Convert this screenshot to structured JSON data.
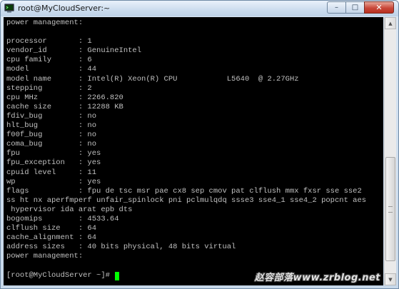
{
  "window": {
    "title": "root@MyCloudServer:~",
    "controls": {
      "minimize_glyph": "–",
      "maximize_glyph": "□",
      "close_glyph": "✕"
    },
    "icon": "terminal-app-icon"
  },
  "terminal": {
    "colors": {
      "background": "#000000",
      "text": "#c0c0c0",
      "cursor": "#00ff00"
    },
    "lines": [
      "power management:",
      "",
      "processor       : 1",
      "vendor_id       : GenuineIntel",
      "cpu family      : 6",
      "model           : 44",
      "model name      : Intel(R) Xeon(R) CPU           L5640  @ 2.27GHz",
      "stepping        : 2",
      "cpu MHz         : 2266.820",
      "cache size      : 12288 KB",
      "fdiv_bug        : no",
      "hlt_bug         : no",
      "f00f_bug        : no",
      "coma_bug        : no",
      "fpu             : yes",
      "fpu_exception   : yes",
      "cpuid level     : 11",
      "wp              : yes",
      "flags           : fpu de tsc msr pae cx8 sep cmov pat clflush mmx fxsr sse sse2",
      "ss ht nx aperfmperf unfair_spinlock pni pclmulqdq ssse3 sse4_1 sse4_2 popcnt aes",
      " hypervisor ida arat epb dts",
      "bogomips        : 4533.64",
      "clflush size    : 64",
      "cache_alignment : 64",
      "address sizes   : 40 bits physical, 48 bits virtual",
      "power management:"
    ],
    "prompt": "[root@MyCloudServer ~]# "
  },
  "scrollbar": {
    "up_arrow": "▲",
    "down_arrow": "▼",
    "position_fraction": 0.58
  },
  "watermark": {
    "text": "赵容部落www.zrblog.net"
  }
}
